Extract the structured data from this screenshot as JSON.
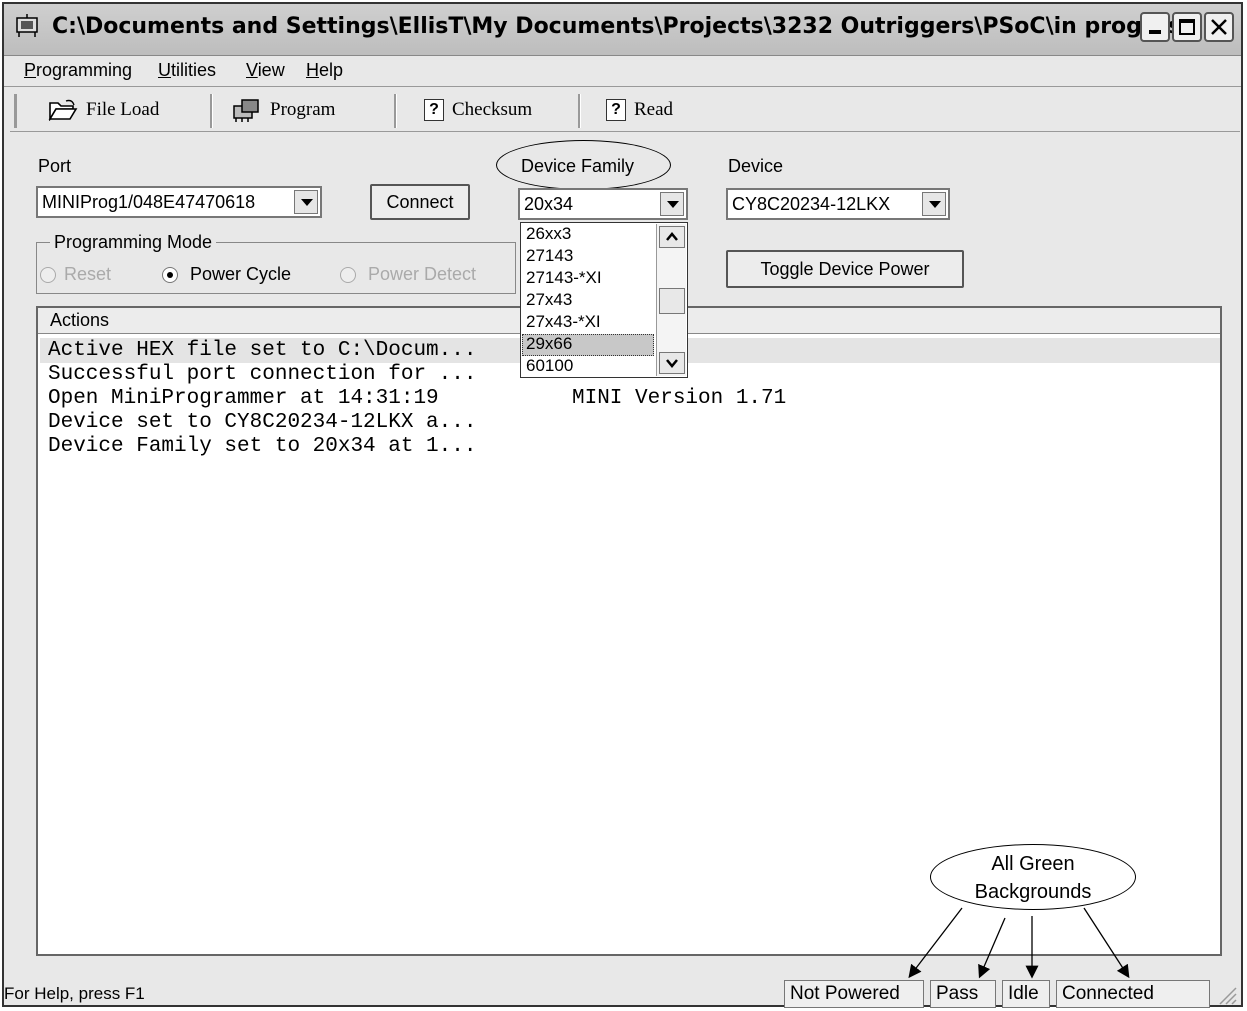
{
  "window": {
    "title": "C:\\Documents and Settings\\EllisT\\My Documents\\Projects\\3232 Outriggers\\PSoC\\in progress...",
    "app_icon": "programmer-icon",
    "caption_buttons": {
      "minimize": "minimize-icon",
      "maximize": "maximize-icon",
      "close": "close-icon"
    }
  },
  "menu": {
    "items": [
      {
        "label": "Programming",
        "underline": "P",
        "rest": "rogramming"
      },
      {
        "label": "Utilities",
        "underline": "U",
        "rest": "tilities"
      },
      {
        "label": "View",
        "underline": "V",
        "rest": "iew"
      },
      {
        "label": "Help",
        "underline": "H",
        "rest": "elp"
      }
    ]
  },
  "toolbar": {
    "file_load": {
      "label": "File Load",
      "icon": "open-folder-icon"
    },
    "program": {
      "label": "Program",
      "icon": "program-chip-icon"
    },
    "checksum": {
      "label": "Checksum",
      "icon": "question-box-icon",
      "glyph": "?"
    },
    "read": {
      "label": "Read",
      "icon": "question-box-icon",
      "glyph": "?"
    }
  },
  "port": {
    "label": "Port",
    "value": "MINIProg1/048E47470618",
    "connect_label": "Connect"
  },
  "device_family": {
    "label": "Device Family",
    "value": "20x34",
    "options": [
      "26xx3",
      "27143",
      "27143-*XI",
      "27x43",
      "27x43-*XI",
      "29x66",
      "60100"
    ],
    "highlighted": "29x66"
  },
  "device": {
    "label": "Device",
    "value": "CY8C20234-12LKX",
    "toggle_power_label": "Toggle Device Power"
  },
  "programming_mode": {
    "label": "Programming Mode",
    "options": [
      {
        "label": "Reset",
        "selected": false,
        "enabled": false
      },
      {
        "label": "Power Cycle",
        "selected": true,
        "enabled": true
      },
      {
        "label": "Power Detect",
        "selected": false,
        "enabled": false
      }
    ]
  },
  "actions": {
    "header": "Actions",
    "log": [
      {
        "left": "Active HEX file set to C:\\Docum...",
        "right": ""
      },
      {
        "left": "Successful port connection for ...",
        "right": ""
      },
      {
        "left": "Open MiniProgrammer at 14:31:19",
        "right": "MINI Version 1.71"
      },
      {
        "left": "Device set to CY8C20234-12LKX a...",
        "right": ""
      },
      {
        "left": "Device Family set to 20x34 at 1...",
        "right": ""
      }
    ]
  },
  "status": {
    "help_text": "For Help, press F1",
    "panes": [
      "Not Powered",
      "Pass",
      "Idle",
      "Connected"
    ]
  },
  "annotation": {
    "line1": "All Green",
    "line2": "Backgrounds"
  }
}
